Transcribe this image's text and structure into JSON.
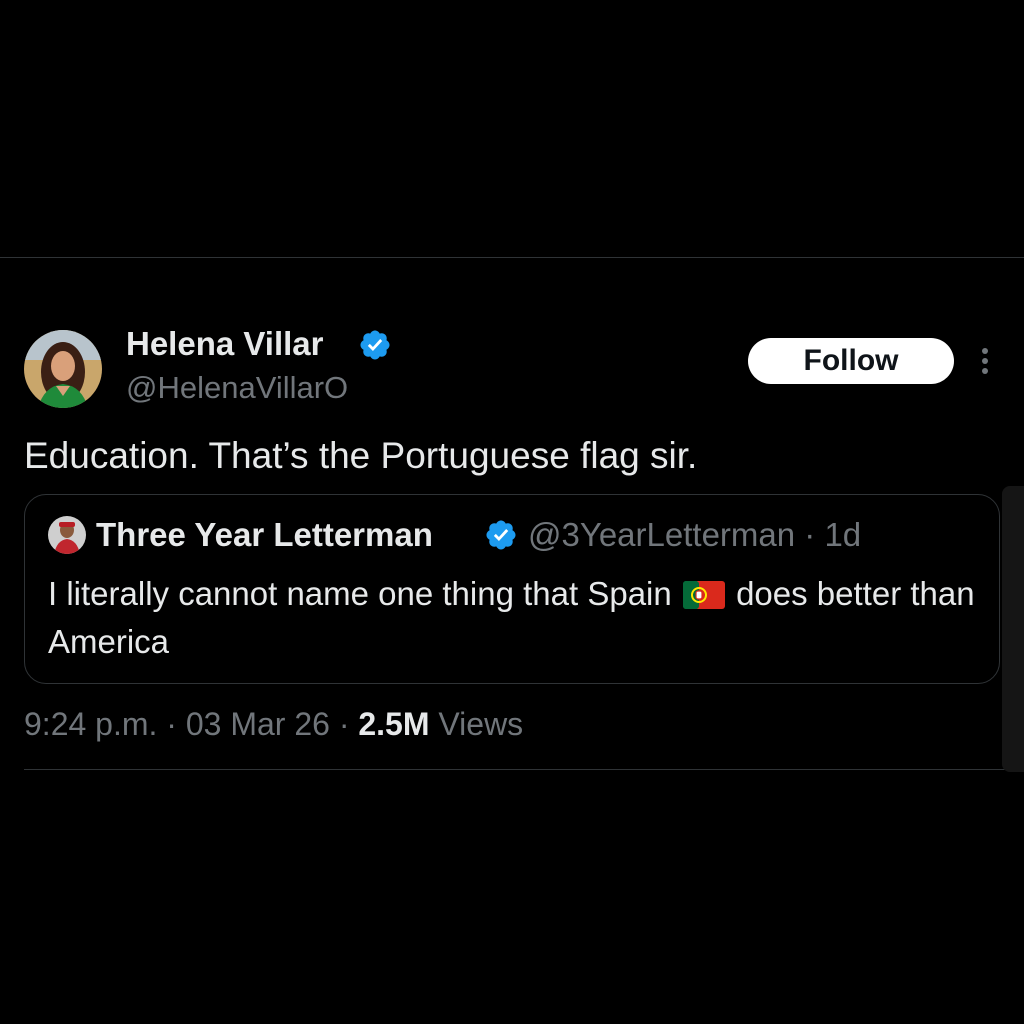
{
  "tweet": {
    "author": {
      "display_name": "Helena Villar",
      "handle": "@HelenaVillarO",
      "verified": true
    },
    "follow_label": "Follow",
    "text": "Education. That’s the Portuguese flag sir.",
    "meta": {
      "time": "9:24 p.m.",
      "separator": " · ",
      "date": "03 Mar 26",
      "views_count": "2.5M",
      "views_label": "Views"
    }
  },
  "quote": {
    "author": {
      "display_name": "Three Year Letterman",
      "handle": "@3YearLetterman",
      "age": "1d",
      "verified": true
    },
    "text_part1": "I literally cannot name one thing that Spain ",
    "flag_icon": "portugal-flag-emoji",
    "text_part2": " does better than America"
  },
  "colors": {
    "background": "#000000",
    "primary_text": "#e7e9ea",
    "secondary_text": "#71767b",
    "divider": "#2f3336",
    "verified_badge": "#1d9bf0",
    "follow_button_bg": "#ffffff"
  }
}
